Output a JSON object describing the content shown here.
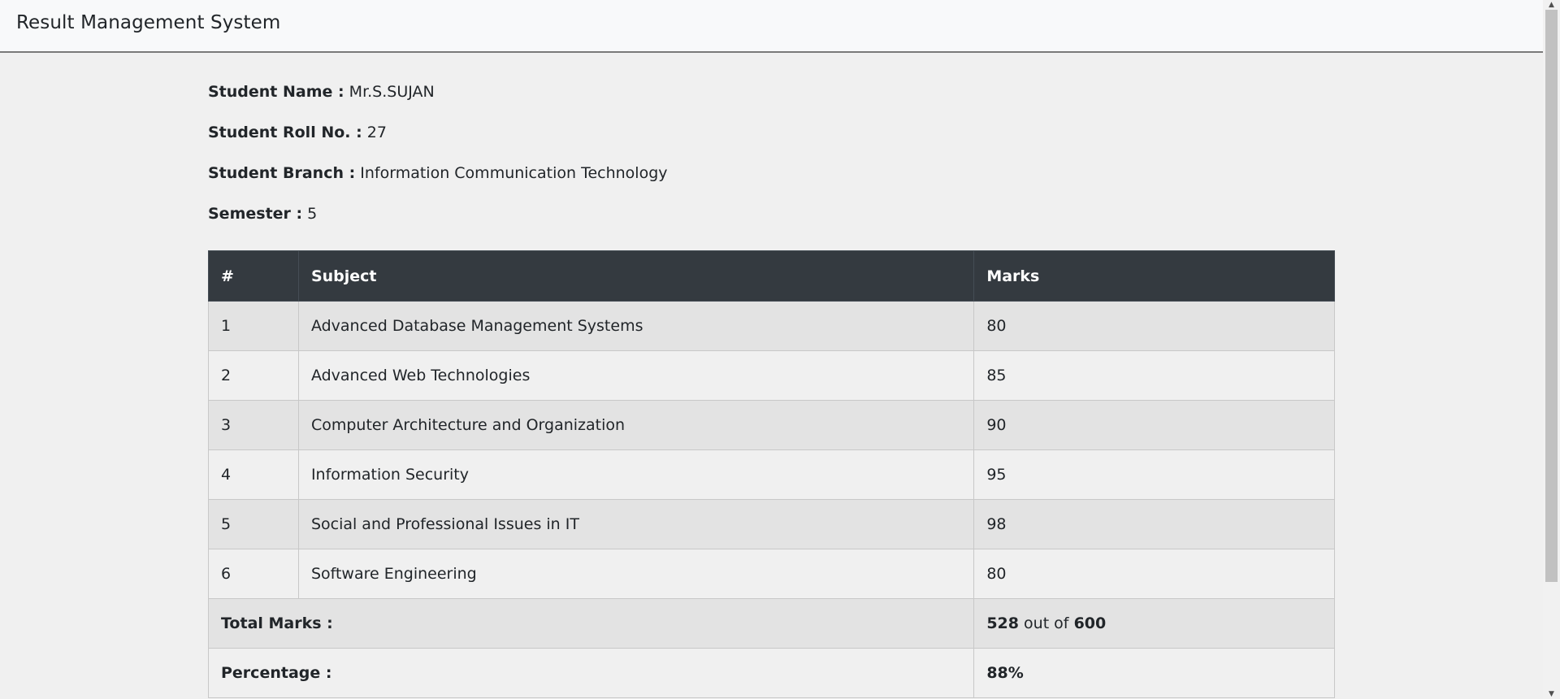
{
  "navbar": {
    "brand": "Result Management System"
  },
  "student": {
    "name_label": "Student Name :",
    "name_value": "Mr.S.SUJAN",
    "roll_label": "Student Roll No. :",
    "roll_value": "27",
    "branch_label": "Student Branch :",
    "branch_value": "Information Communication Technology",
    "semester_label": "Semester :",
    "semester_value": "5"
  },
  "table": {
    "headers": [
      "#",
      "Subject",
      "Marks"
    ],
    "rows": [
      {
        "num": "1",
        "subject": "Advanced Database Management Systems",
        "marks": "80"
      },
      {
        "num": "2",
        "subject": "Advanced Web Technologies",
        "marks": "85"
      },
      {
        "num": "3",
        "subject": "Computer Architecture and Organization",
        "marks": "90"
      },
      {
        "num": "4",
        "subject": "Information Security",
        "marks": "95"
      },
      {
        "num": "5",
        "subject": "Social and Professional Issues in IT",
        "marks": "98"
      },
      {
        "num": "6",
        "subject": "Software Engineering",
        "marks": "80"
      }
    ],
    "total": {
      "label": "Total Marks :",
      "obtained": "528",
      "out_of_text": "out of",
      "maximum": "600"
    },
    "percentage": {
      "label": "Percentage :",
      "value": "88%"
    }
  },
  "scrollbar": {
    "up_glyph": "▲",
    "down_glyph": "▼"
  }
}
